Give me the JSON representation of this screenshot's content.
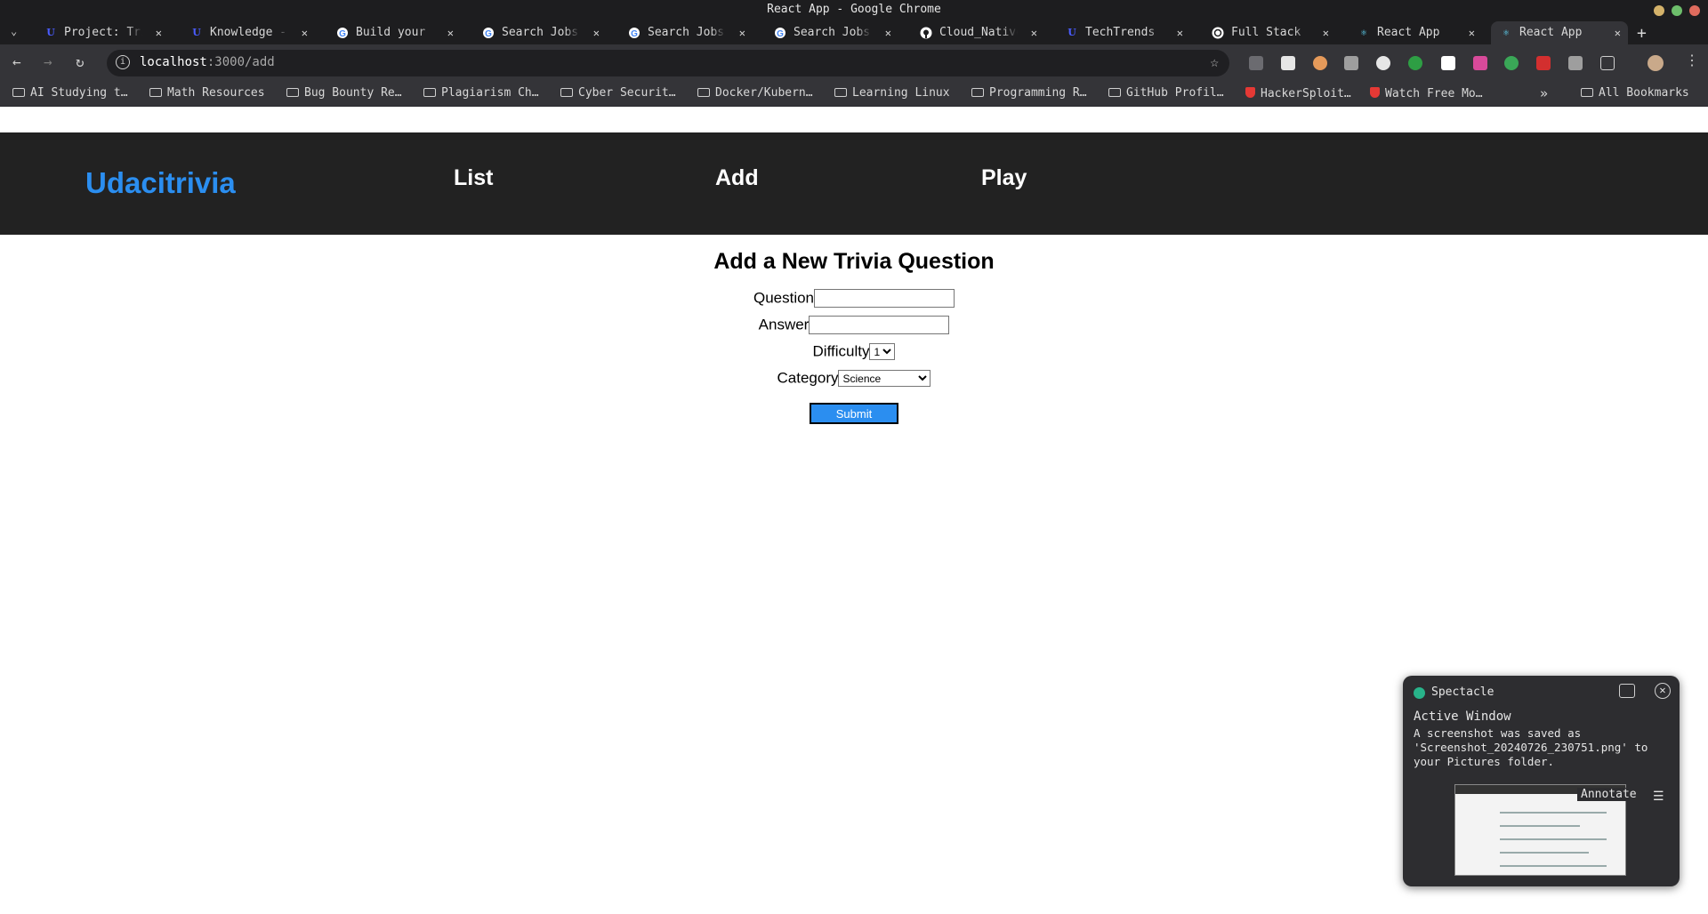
{
  "window": {
    "title": "React App - Google Chrome"
  },
  "tabs": [
    {
      "title": "Project: Trivia",
      "icon": "udacity-icon"
    },
    {
      "title": "Knowledge - Udacity",
      "icon": "udacity-icon"
    },
    {
      "title": "Build your resume",
      "icon": "google-icon"
    },
    {
      "title": "Search Jobs",
      "icon": "google-icon"
    },
    {
      "title": "Search Jobs",
      "icon": "google-icon"
    },
    {
      "title": "Search Jobs",
      "icon": "google-icon"
    },
    {
      "title": "Cloud_Native",
      "icon": "github-icon"
    },
    {
      "title": "TechTrends - Udacity",
      "icon": "udacity-icon"
    },
    {
      "title": "Full Stack",
      "icon": "openai-icon"
    },
    {
      "title": "React App",
      "icon": "react-icon"
    },
    {
      "title": "React App",
      "icon": "react-icon",
      "active": true
    }
  ],
  "tab_close": "✕",
  "new_tab": "+",
  "address_bar": {
    "host": "localhost",
    "path": ":3000/add"
  },
  "bookmarks": [
    {
      "label": "AI Studying t…",
      "type": "folder"
    },
    {
      "label": "Math Resources",
      "type": "folder"
    },
    {
      "label": "Bug Bounty Re…",
      "type": "folder"
    },
    {
      "label": "Plagiarism Ch…",
      "type": "folder"
    },
    {
      "label": "Cyber Securit…",
      "type": "folder"
    },
    {
      "label": "Docker/Kubern…",
      "type": "folder"
    },
    {
      "label": "Learning Linux",
      "type": "folder"
    },
    {
      "label": "Programming R…",
      "type": "folder"
    },
    {
      "label": "GitHub Profil…",
      "type": "folder"
    },
    {
      "label": "HackerSploit…",
      "type": "site"
    },
    {
      "label": "Watch Free Mo…",
      "type": "site"
    }
  ],
  "bookmarks_more": "»",
  "all_bookmarks": "All Bookmarks",
  "app": {
    "brand": "Udacitrivia",
    "nav": {
      "list": "List",
      "add": "Add",
      "play": "Play"
    },
    "form": {
      "title": "Add a New Trivia Question",
      "question_label": "Question",
      "question_value": "",
      "answer_label": "Answer",
      "answer_value": "",
      "difficulty_label": "Difficulty",
      "difficulty_value": "1",
      "category_label": "Category",
      "category_value": "Science",
      "submit_label": "Submit"
    },
    "colors": {
      "brand": "#2b8ef0",
      "nav_bg": "#222222",
      "submit_bg": "#2b8ef0"
    }
  },
  "notification": {
    "app": "Spectacle",
    "title": "Active Window",
    "body": "A screenshot was saved as 'Screenshot_20240726_230751.png' to your Pictures folder.",
    "action": "Annotate"
  }
}
